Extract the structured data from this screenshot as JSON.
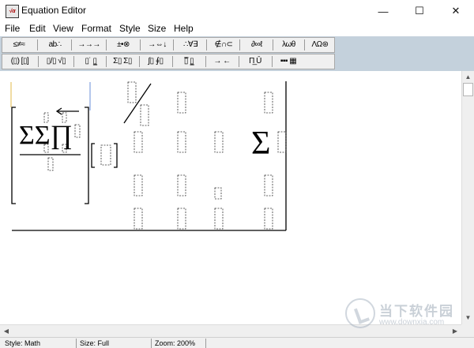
{
  "window": {
    "title": "Equation Editor",
    "icon": "equation-editor-app-icon",
    "controls": {
      "minimize": "—",
      "maximize": "☐",
      "close": "✕"
    }
  },
  "menubar": {
    "items": [
      "File",
      "Edit",
      "View",
      "Format",
      "Style",
      "Size",
      "Help"
    ]
  },
  "toolbar": {
    "row1": [
      "≤≠≈",
      " ab∴",
      " →→→",
      "±•⊗",
      "→⇔↓",
      "∴∀∃",
      "∉∩⊂",
      "∂∞ℓ",
      "λωθ",
      "ΛΩ⊛"
    ],
    "row2": [
      "(▯) [▯]",
      "▯/▯ √▯",
      "▯˙ ▯̲",
      "Σ▯ Σ▯",
      "∫▯ ∮▯",
      "▯̅ ▯̲",
      "→ ←",
      "Π̲ Ū",
      "▪▪▪ ▦"
    ]
  },
  "equation": {
    "sum_sum_product": "ΣΣ∏",
    "right_sigma": "Σ"
  },
  "scrollbars": {
    "up": "▲",
    "down": "▼",
    "left": "◀",
    "right": "▶"
  },
  "status": {
    "style": "Style: Math",
    "size": "Size: Full",
    "zoom": "Zoom: 200%"
  },
  "watermark": {
    "title": "当下软件园",
    "url": "www.downxia.com"
  }
}
